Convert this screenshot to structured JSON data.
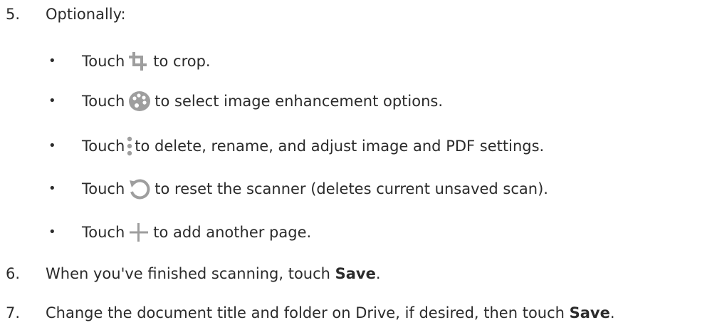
{
  "steps": [
    {
      "number": "5.",
      "text": "Optionally:"
    },
    {
      "number": "6.",
      "text_before": "When you've finished scanning, touch ",
      "bold": "Save",
      "text_after": "."
    },
    {
      "number": "7.",
      "text_before": "Change the document title and folder on Drive, if desired, then touch ",
      "bold": "Save",
      "text_after": "."
    }
  ],
  "bullet_char": "•",
  "bullets": [
    {
      "prefix": "Touch",
      "icon": "crop-icon",
      "suffix": "to crop."
    },
    {
      "prefix": "Touch",
      "icon": "palette-icon",
      "suffix": "to select image enhancement options."
    },
    {
      "prefix": "Touch",
      "icon": "more-vert-icon",
      "suffix": "to delete, rename, and adjust image and PDF settings."
    },
    {
      "prefix": "Touch",
      "icon": "reset-icon",
      "suffix": "to reset the scanner (deletes current unsaved scan)."
    },
    {
      "prefix": "Touch",
      "icon": "add-icon",
      "suffix": "to add another page."
    }
  ],
  "colors": {
    "text": "#2b2b2b",
    "icon": "#9e9e9e"
  }
}
